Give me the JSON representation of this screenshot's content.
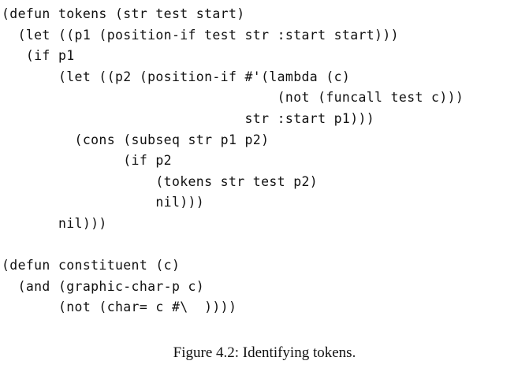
{
  "figure": {
    "code_lines": [
      "(defun tokens (str test start)",
      "  (let ((p1 (position-if test str :start start)))",
      "   (if p1",
      "       (let ((p2 (position-if #'(lambda (c)",
      "                                  (not (funcall test c)))",
      "                              str :start p1)))",
      "         (cons (subseq str p1 p2)",
      "               (if p2",
      "                   (tokens str test p2)",
      "                   nil)))",
      "       nil)))",
      "",
      "(defun constituent (c)",
      "  (and (graphic-char-p c)",
      "       (not (char= c #\\  ))))"
    ],
    "caption": "Figure 4.2: Identifying tokens."
  }
}
